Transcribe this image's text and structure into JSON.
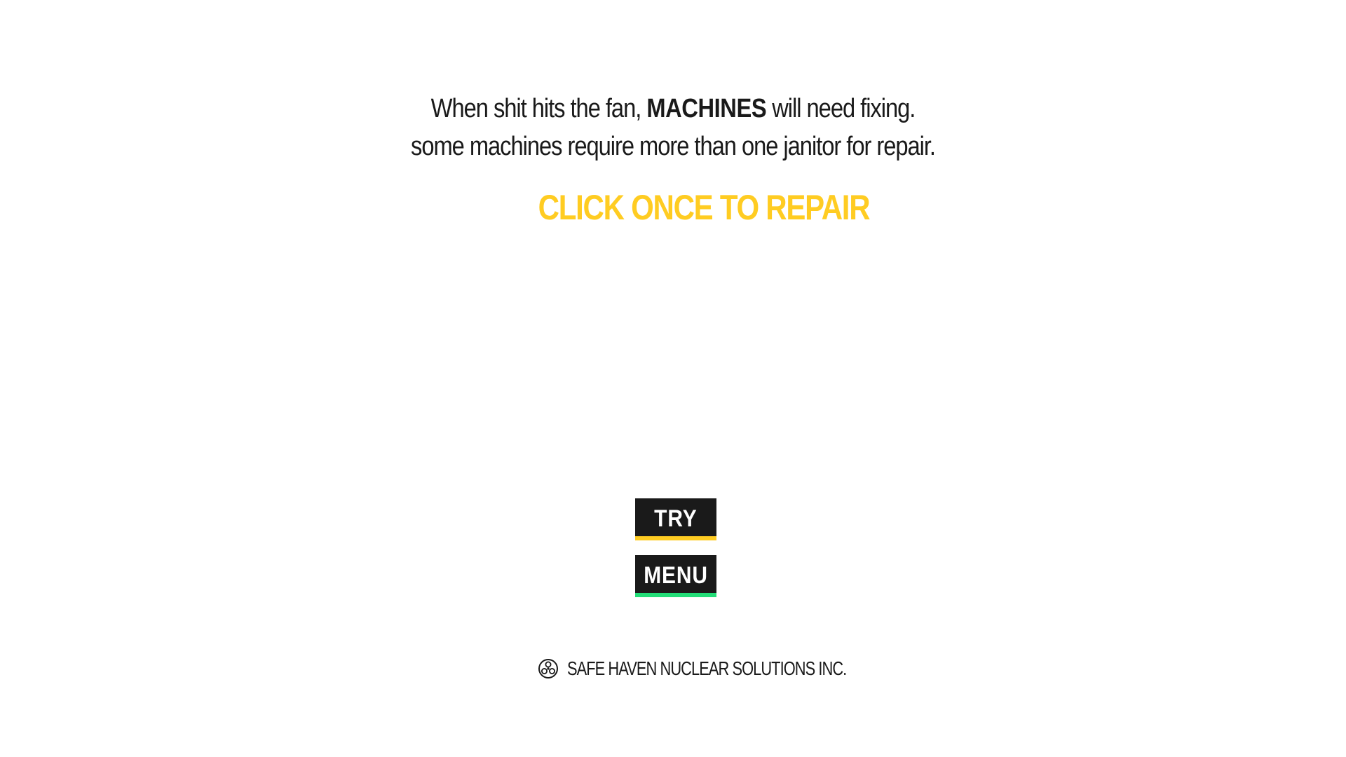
{
  "intro": {
    "line1_before": "When shit hits the fan, ",
    "line1_bold": "MACHINES",
    "line1_after": " will need fixing.",
    "line2": "some machines require more than one janitor for repair."
  },
  "cta": {
    "text": "CLICK ONCE TO REPAIR",
    "color": "#ffcc22"
  },
  "buttons": {
    "try_label": "TRY",
    "try_accent": "#ffcc22",
    "menu_label": "MENU",
    "menu_accent": "#22dd77"
  },
  "footer": {
    "icon": "radiation-icon",
    "company": "SAFE HAVEN NUCLEAR SOLUTIONS INC."
  }
}
